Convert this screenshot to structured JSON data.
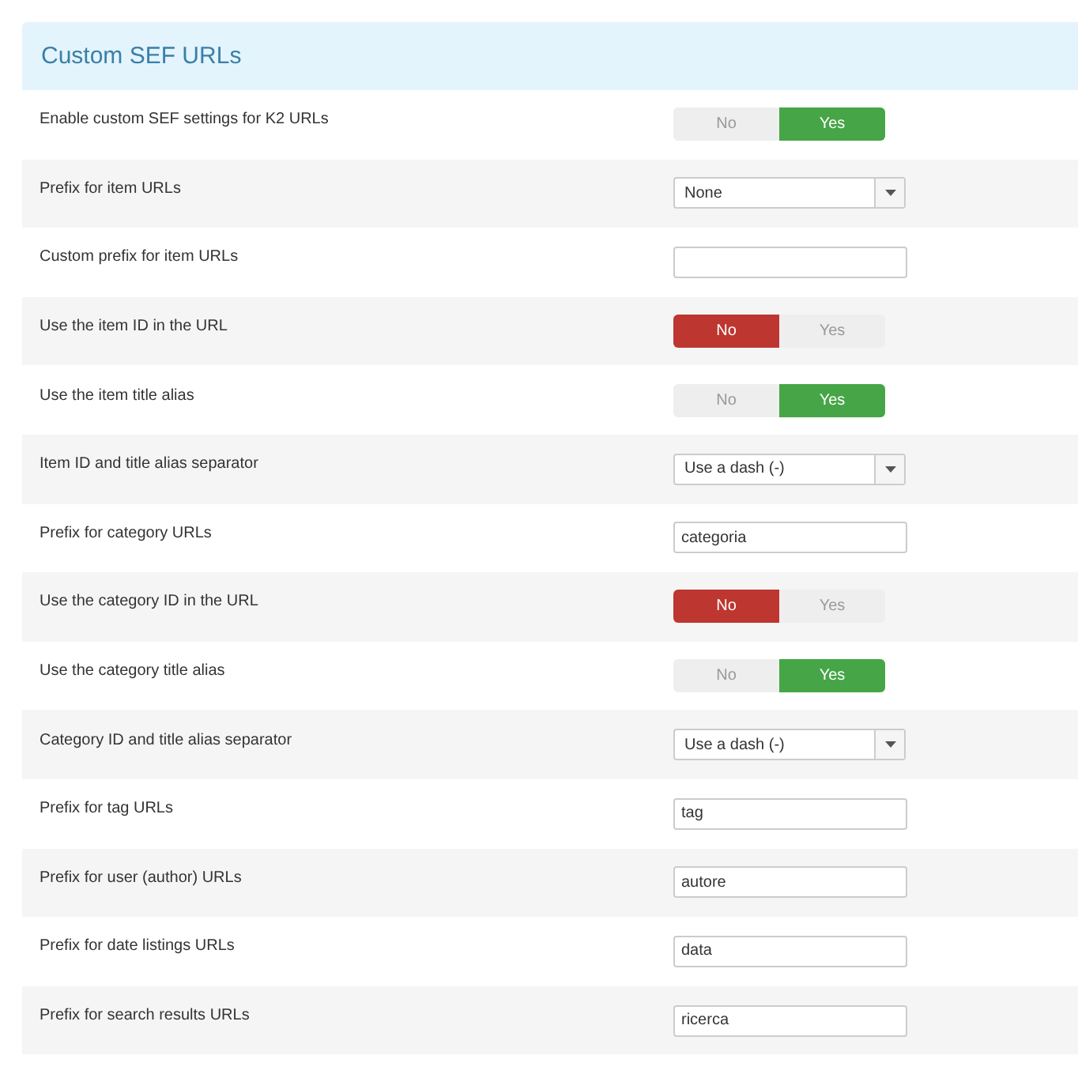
{
  "panel": {
    "title": "Custom SEF URLs"
  },
  "rows": [
    {
      "label": "Enable custom SEF settings for K2 URLs",
      "kind": "toggle",
      "options": [
        {
          "label": "No",
          "selected": false
        },
        {
          "label": "Yes",
          "selected": true
        }
      ]
    },
    {
      "label": "Prefix for item URLs",
      "kind": "select",
      "value": "None"
    },
    {
      "label": "Custom prefix for item URLs",
      "kind": "text"
    },
    {
      "label": "Use the item ID in the URL",
      "kind": "toggle",
      "options": [
        {
          "label": "No",
          "selected": true
        },
        {
          "label": "Yes",
          "selected": false
        }
      ]
    },
    {
      "label": "Use the item title alias",
      "kind": "toggle",
      "options": [
        {
          "label": "No",
          "selected": false
        },
        {
          "label": "Yes",
          "selected": true
        }
      ]
    },
    {
      "label": "Item ID and title alias separator",
      "kind": "select",
      "value": "Use a dash (-)"
    },
    {
      "label": "Prefix for category URLs",
      "kind": "text",
      "value": "categoria"
    },
    {
      "label": "Use the category ID in the URL",
      "kind": "toggle",
      "options": [
        {
          "label": "No",
          "selected": true
        },
        {
          "label": "Yes",
          "selected": false
        }
      ]
    },
    {
      "label": "Use the category title alias",
      "kind": "toggle",
      "options": [
        {
          "label": "No",
          "selected": false
        },
        {
          "label": "Yes",
          "selected": true
        }
      ]
    },
    {
      "label": "Category ID and title alias separator",
      "kind": "select",
      "value": "Use a dash (-)"
    },
    {
      "label": "Prefix for tag URLs",
      "kind": "text",
      "value": "tag"
    },
    {
      "label": "Prefix for user (author) URLs",
      "kind": "text",
      "value": "autore"
    },
    {
      "label": "Prefix for date listings URLs",
      "kind": "text",
      "value": "data"
    },
    {
      "label": "Prefix for search results URLs",
      "kind": "text",
      "value": "ricerca"
    }
  ]
}
